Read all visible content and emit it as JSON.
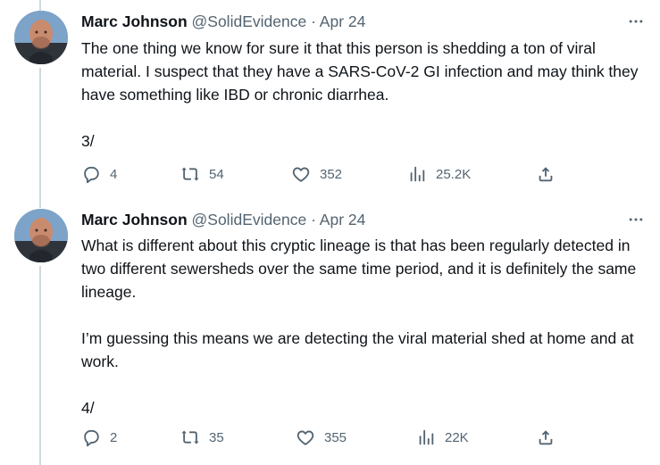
{
  "tweets": [
    {
      "author_name": "Marc Johnson",
      "handle": "@SolidEvidence",
      "separator": "·",
      "date": "Apr 24",
      "more_icon": "more-horizontal-icon",
      "paragraphs": [
        "The one thing we know for sure it that this person is shedding a ton of viral material. I suspect that they have a SARS-CoV-2 GI infection and may think they have something like IBD or chronic diarrhea.",
        "3/"
      ],
      "actions": {
        "replies": "4",
        "retweets": "54",
        "likes": "352",
        "views": "25.2K"
      }
    },
    {
      "author_name": "Marc Johnson",
      "handle": "@SolidEvidence",
      "separator": "·",
      "date": "Apr 24",
      "more_icon": "more-horizontal-icon",
      "paragraphs": [
        "What is different about this cryptic lineage is that has been regularly detected in two different sewersheds over the same time period, and it is definitely the same lineage.",
        "I’m guessing this means we are detecting the viral material shed at home and at work.",
        "4/"
      ],
      "actions": {
        "replies": "2",
        "retweets": "35",
        "likes": "355",
        "views": "22K"
      }
    }
  ],
  "colors": {
    "text": "#0f1419",
    "muted": "#536471",
    "thread_line": "#cfd9de"
  }
}
